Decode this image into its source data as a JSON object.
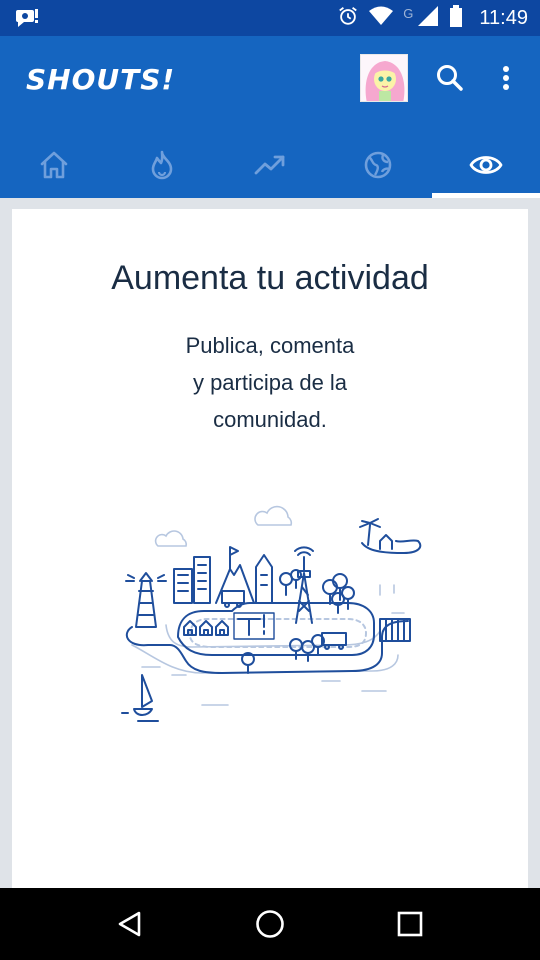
{
  "status_bar": {
    "time": "11:49",
    "network_label": "G",
    "icons": [
      "notification-icon",
      "alarm-icon",
      "wifi-icon",
      "signal-icon",
      "battery-icon"
    ]
  },
  "app_bar": {
    "title": "SHOUTS!",
    "avatar": "avatar",
    "actions": [
      "search-icon",
      "more-vert-icon"
    ]
  },
  "tabs": [
    {
      "icon": "home-icon",
      "selected": false
    },
    {
      "icon": "flame-icon",
      "selected": false
    },
    {
      "icon": "trending-icon",
      "selected": false
    },
    {
      "icon": "globe-icon",
      "selected": false
    },
    {
      "icon": "eye-icon",
      "selected": true
    }
  ],
  "empty_state": {
    "title": "Aumenta tu actividad",
    "body_lines": [
      "Publica, comenta",
      "y participa de la",
      "comunidad."
    ]
  },
  "nav_bar": {
    "buttons": [
      "back-icon",
      "home-circle-icon",
      "recents-icon"
    ]
  },
  "colors": {
    "primary": "#1565c0",
    "status_bar": "#0d47a1",
    "text_dark": "#1a2d44",
    "illustration_blue": "#1f4e9c",
    "illustration_light": "#b7c7e0"
  }
}
